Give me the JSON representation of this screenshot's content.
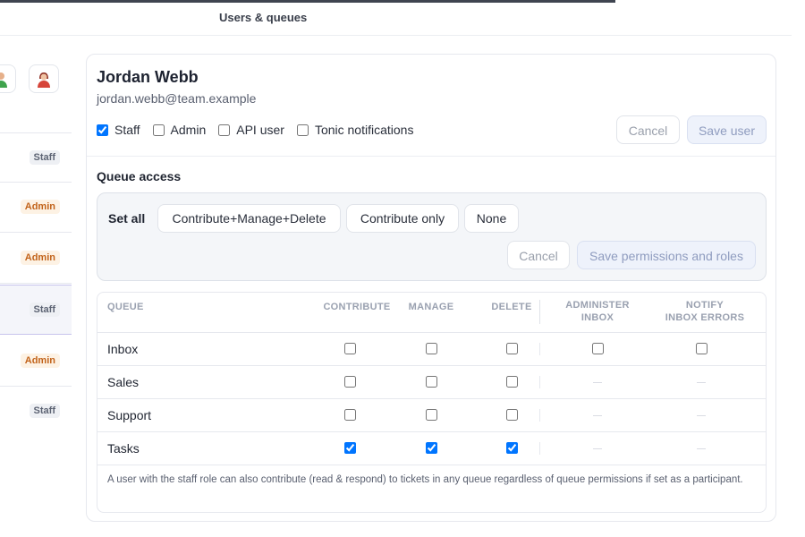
{
  "header": {
    "title": "Users & queues"
  },
  "sidebar": {
    "avatars": [
      {
        "icon": "user-green-icon"
      },
      {
        "icon": "user-red-icon"
      }
    ],
    "rows": [
      {
        "badge": "Staff",
        "type": "staff"
      },
      {
        "badge": "Admin",
        "type": "admin"
      },
      {
        "badge": "Admin",
        "type": "admin"
      },
      {
        "badge": "Staff",
        "type": "staff"
      },
      {
        "badge": "Admin",
        "type": "admin"
      },
      {
        "badge": "Staff",
        "type": "staff"
      }
    ]
  },
  "user": {
    "name": "Jordan Webb",
    "email": "jordan.webb@team.example",
    "roles": [
      {
        "label": "Staff",
        "checked": true
      },
      {
        "label": "Admin",
        "checked": false
      },
      {
        "label": "API user",
        "checked": false
      },
      {
        "label": "Tonic notifications",
        "checked": false
      }
    ],
    "cancel_label": "Cancel",
    "save_label": "Save user"
  },
  "queue_access": {
    "title": "Queue access",
    "set_all_label": "Set all",
    "presets": [
      "Contribute+Manage+Delete",
      "Contribute only",
      "None"
    ],
    "cancel_label": "Cancel",
    "save_label": "Save permissions and roles"
  },
  "table": {
    "headers": {
      "queue": "QUEUE",
      "contribute": "CONTRIBUTE",
      "manage": "MANAGE",
      "delete": "DELETE",
      "administer_1": "ADMINISTER",
      "administer_2": "INBOX",
      "notify_1": "NOTIFY",
      "notify_2": "INBOX ERRORS"
    },
    "rows": [
      {
        "name": "Inbox",
        "contribute": false,
        "manage": false,
        "delete": false,
        "administer": false,
        "notify": false,
        "inbox_options": true
      },
      {
        "name": "Sales",
        "contribute": false,
        "manage": false,
        "delete": false,
        "inbox_options": false,
        "na": "—"
      },
      {
        "name": "Support",
        "contribute": false,
        "manage": false,
        "delete": false,
        "inbox_options": false,
        "na": "—"
      },
      {
        "name": "Tasks",
        "contribute": true,
        "manage": true,
        "delete": true,
        "inbox_options": false,
        "na": "—"
      }
    ],
    "footnote": "A user with the staff role can also contribute (read & respond) to tickets in any queue regardless of queue permissions if set as a participant."
  }
}
